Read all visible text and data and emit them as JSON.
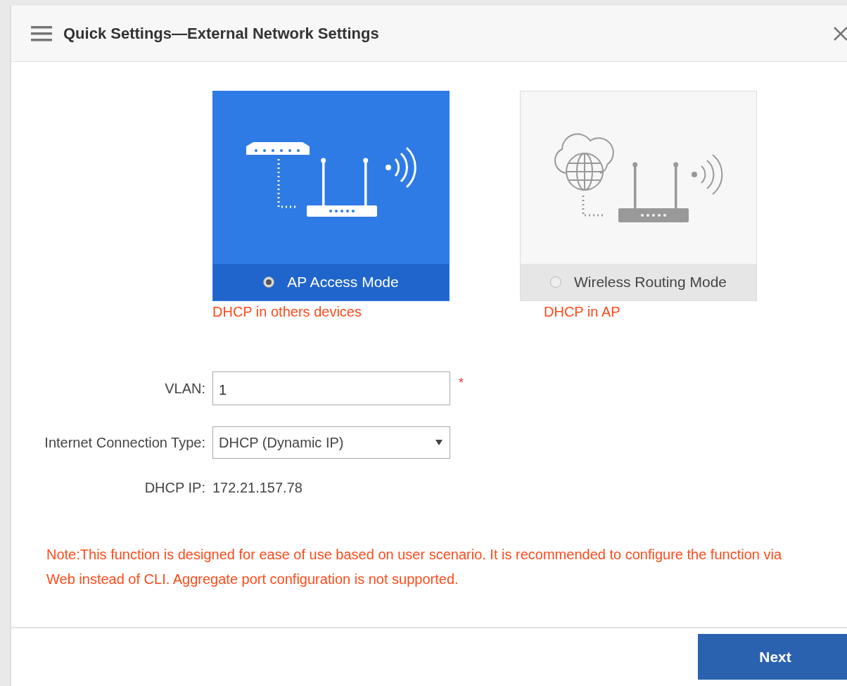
{
  "window": {
    "title": "Quick Settings—External Network Settings"
  },
  "modes": [
    {
      "kind": "access",
      "label": "AP Access Mode",
      "selected": true,
      "note": "DHCP in others devices"
    },
    {
      "kind": "routing",
      "label": "Wireless Routing Mode",
      "selected": false,
      "note": "DHCP in AP"
    }
  ],
  "form": {
    "vlan": {
      "label": "VLAN:",
      "value": "1",
      "required_mark": "*"
    },
    "connection_type": {
      "label": "Internet Connection Type:",
      "value": "DHCP (Dynamic IP)"
    },
    "dhcp_ip": {
      "label": "DHCP IP:",
      "value": "172.21.157.78"
    }
  },
  "note": "Note:This function is designed for ease of use based on user scenario. It is recommended to configure the function via Web instead of CLI. Aggregate port configuration is not supported.",
  "buttons": [
    {
      "label": "Next"
    }
  ]
}
